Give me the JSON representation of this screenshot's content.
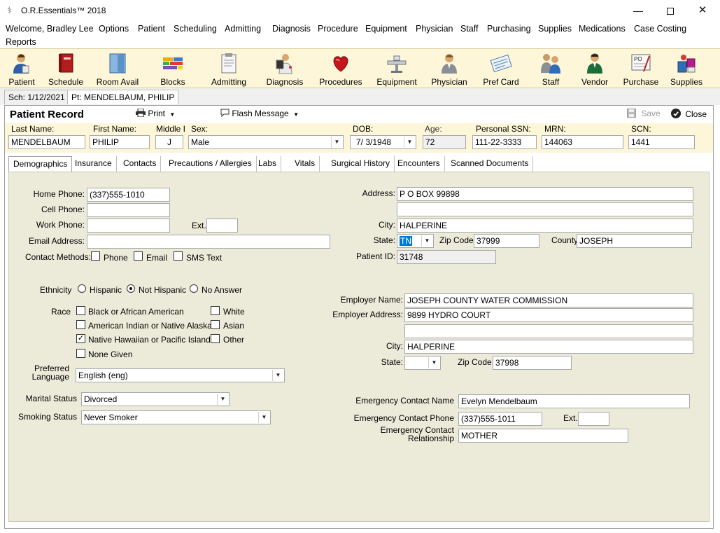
{
  "window": {
    "title": "O.R.Essentials™ 2018",
    "minimize_glyph": "—",
    "close_glyph": "✕"
  },
  "menu": {
    "items": [
      "Welcome, Bradley  Lee",
      "Options",
      "Patient",
      "Scheduling",
      "Admitting",
      "Diagnosis",
      "Procedure",
      "Equipment",
      "Physician",
      "Staff",
      "Purchasing",
      "Supplies",
      "Medications",
      "Case Costing",
      "Reports"
    ]
  },
  "toolbar": {
    "items": [
      {
        "label": "Patient",
        "icon": "patient-icon"
      },
      {
        "label": "Schedule",
        "icon": "schedule-book-icon"
      },
      {
        "label": "Room Avail",
        "icon": "room-door-icon"
      },
      {
        "label": "Blocks",
        "icon": "blocks-icon"
      },
      {
        "label": "Admitting",
        "icon": "clipboard-icon"
      },
      {
        "label": "Diagnosis",
        "icon": "doctor-xray-icon"
      },
      {
        "label": "Procedures",
        "icon": "heart-icon"
      },
      {
        "label": "Equipment",
        "icon": "surgical-table-icon"
      },
      {
        "label": "Physician",
        "icon": "physician-icon"
      },
      {
        "label": "Pref Card",
        "icon": "pref-card-icon"
      },
      {
        "label": "Staff",
        "icon": "staff-group-icon"
      },
      {
        "label": "Vendor",
        "icon": "vendor-icon"
      },
      {
        "label": "Purchase",
        "icon": "purchase-order-icon"
      },
      {
        "label": "Supplies",
        "icon": "supplies-icon"
      }
    ],
    "purchase_icon_text": "PO"
  },
  "doc_tabs": [
    {
      "label": "Sch: 1/12/2021",
      "active": false
    },
    {
      "label": "Pt: MENDELBAUM, PHILIP",
      "active": true
    }
  ],
  "record": {
    "title": "Patient Record",
    "print_label": "Print",
    "flash_label": "Flash Message",
    "save_label": "Save",
    "close_label": "Close"
  },
  "patient": {
    "last_name_label": "Last Name:",
    "last_name": "MENDELBAUM",
    "first_name_label": "First Name:",
    "first_name": "PHILIP",
    "middle_label": "Middle I",
    "middle": "J",
    "sex_label": "Sex:",
    "sex": "Male",
    "dob_label": "DOB:",
    "dob": "7/  3/1948",
    "age_label": "Age:",
    "age": "72",
    "ssn_label": "Personal SSN:",
    "ssn": "111-22-3333",
    "mrn_label": "MRN:",
    "mrn": "144063",
    "scn_label": "SCN:",
    "scn": "1441"
  },
  "section_tabs": [
    "Demographics",
    "Insurance",
    "Contacts",
    "Precautions / Allergies",
    "Labs",
    "Vitals",
    "Surgical History",
    "Encounters",
    "Scanned Documents"
  ],
  "demographics": {
    "home_phone_label": "Home Phone:",
    "home_phone": "(337)555-1010",
    "cell_phone_label": "Cell Phone:",
    "cell_phone": "",
    "work_phone_label": "Work Phone:",
    "work_phone": "",
    "ext_label": "Ext.",
    "ext": "",
    "email_label": "Email Address:",
    "email": "",
    "contact_methods_label": "Contact Methods:",
    "contact_methods": [
      "Phone",
      "Email",
      "SMS Text"
    ],
    "ethnicity_label": "Ethnicity",
    "ethnicity_options": [
      "Hispanic",
      "Not Hispanic",
      "No Answer"
    ],
    "ethnicity_selected": "Not Hispanic",
    "race_label": "Race",
    "race_options": [
      "Black or African American",
      "White",
      "American Indian or Native Alaskan",
      "Asian",
      "Native Hawaiian or Pacific Islander",
      "Other",
      "None Given"
    ],
    "race_checked": "Native Hawaiian or Pacific Islander",
    "preferred_language_label_1": "Preferred",
    "preferred_language_label_2": "Language",
    "preferred_language": "English (eng)",
    "marital_status_label": "Marital Status",
    "marital_status": "Divorced",
    "smoking_status_label": "Smoking Status",
    "smoking_status": "Never Smoker",
    "address_label": "Address:",
    "address_1": "P O BOX 99898",
    "address_2": "",
    "city_label": "City:",
    "city": "HALPERINE",
    "state_label": "State:",
    "state": "TN",
    "zip_label": "Zip Code:",
    "zip": "37999",
    "county_label": "County",
    "county": "JOSEPH",
    "patient_id_label": "Patient ID:",
    "patient_id": "31748",
    "employer_name_label": "Employer Name:",
    "employer_name": "JOSEPH COUNTY WATER COMMISSION",
    "employer_address_label": "Employer Address:",
    "employer_address_1": "9899 HYDRO COURT",
    "employer_address_2": "",
    "employer_city_label": "City:",
    "employer_city": "HALPERINE",
    "employer_state_label": "State:",
    "employer_state": "",
    "employer_zip_label": "Zip Code:",
    "employer_zip": "37998",
    "emergency_name_label": "Emergency Contact Name",
    "emergency_name": "Evelyn Mendelbaum",
    "emergency_phone_label": "Emergency Contact Phone",
    "emergency_phone": "(337)555-1011",
    "emergency_ext_label": "Ext.",
    "emergency_ext": "",
    "emergency_rel_label_1": "Emergency Contact",
    "emergency_rel_label_2": "Relationship",
    "emergency_relationship": "MOTHER"
  }
}
